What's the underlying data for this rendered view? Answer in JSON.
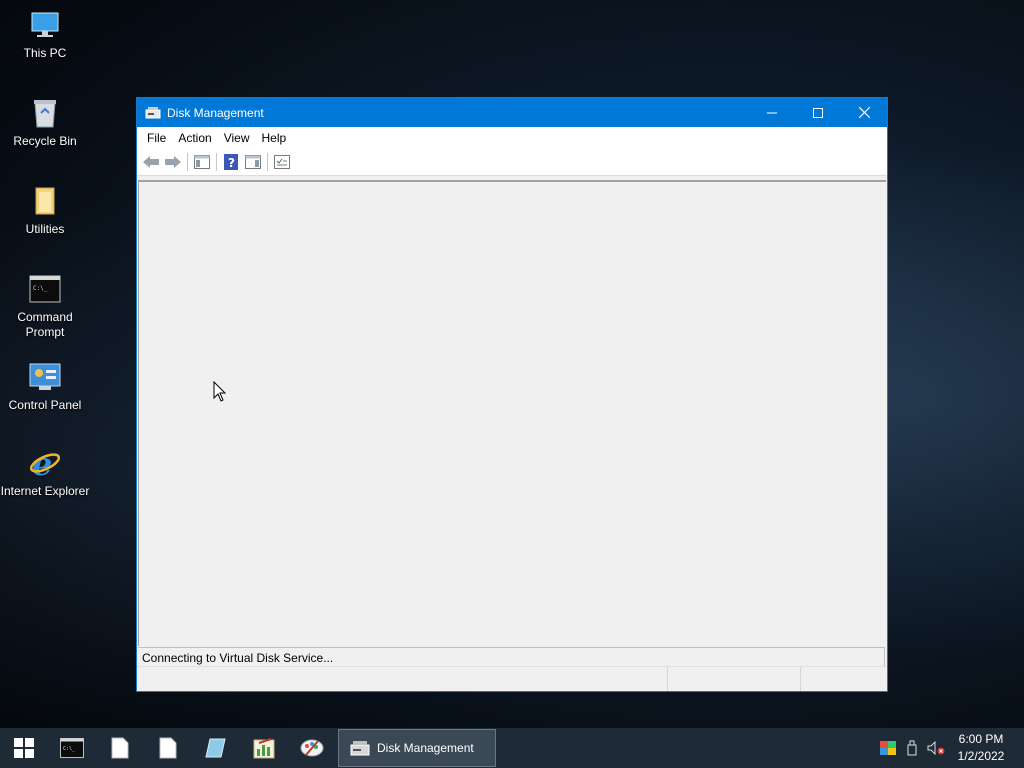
{
  "desktop": {
    "icons": [
      {
        "label": "This PC",
        "icon": "monitor-icon"
      },
      {
        "label": "Recycle Bin",
        "icon": "recycle-bin-icon"
      },
      {
        "label": "Utilities",
        "icon": "folder-icon"
      },
      {
        "label": "Command Prompt",
        "icon": "command-prompt-icon"
      },
      {
        "label": "Control Panel",
        "icon": "control-panel-icon"
      },
      {
        "label": "Internet Explorer",
        "icon": "internet-explorer-icon"
      }
    ]
  },
  "window": {
    "title": "Disk Management",
    "menu": [
      "File",
      "Action",
      "View",
      "Help"
    ],
    "toolbar": [
      "back-icon",
      "forward-icon",
      "show-hide-tree-icon",
      "help-icon",
      "show-hide-action-pane-icon",
      "properties-icon"
    ],
    "status_message": "Connecting to Virtual Disk Service..."
  },
  "taskbar": {
    "active_task": "Disk Management",
    "pinned": [
      "command-prompt-icon",
      "document-icon",
      "document-icon",
      "notepad-icon",
      "chart-app-icon",
      "paint-icon"
    ],
    "time": "6:00 PM",
    "date": "1/2/2022"
  },
  "colors": {
    "titlebar": "#0078d7",
    "taskbar": "#1e2a36"
  }
}
